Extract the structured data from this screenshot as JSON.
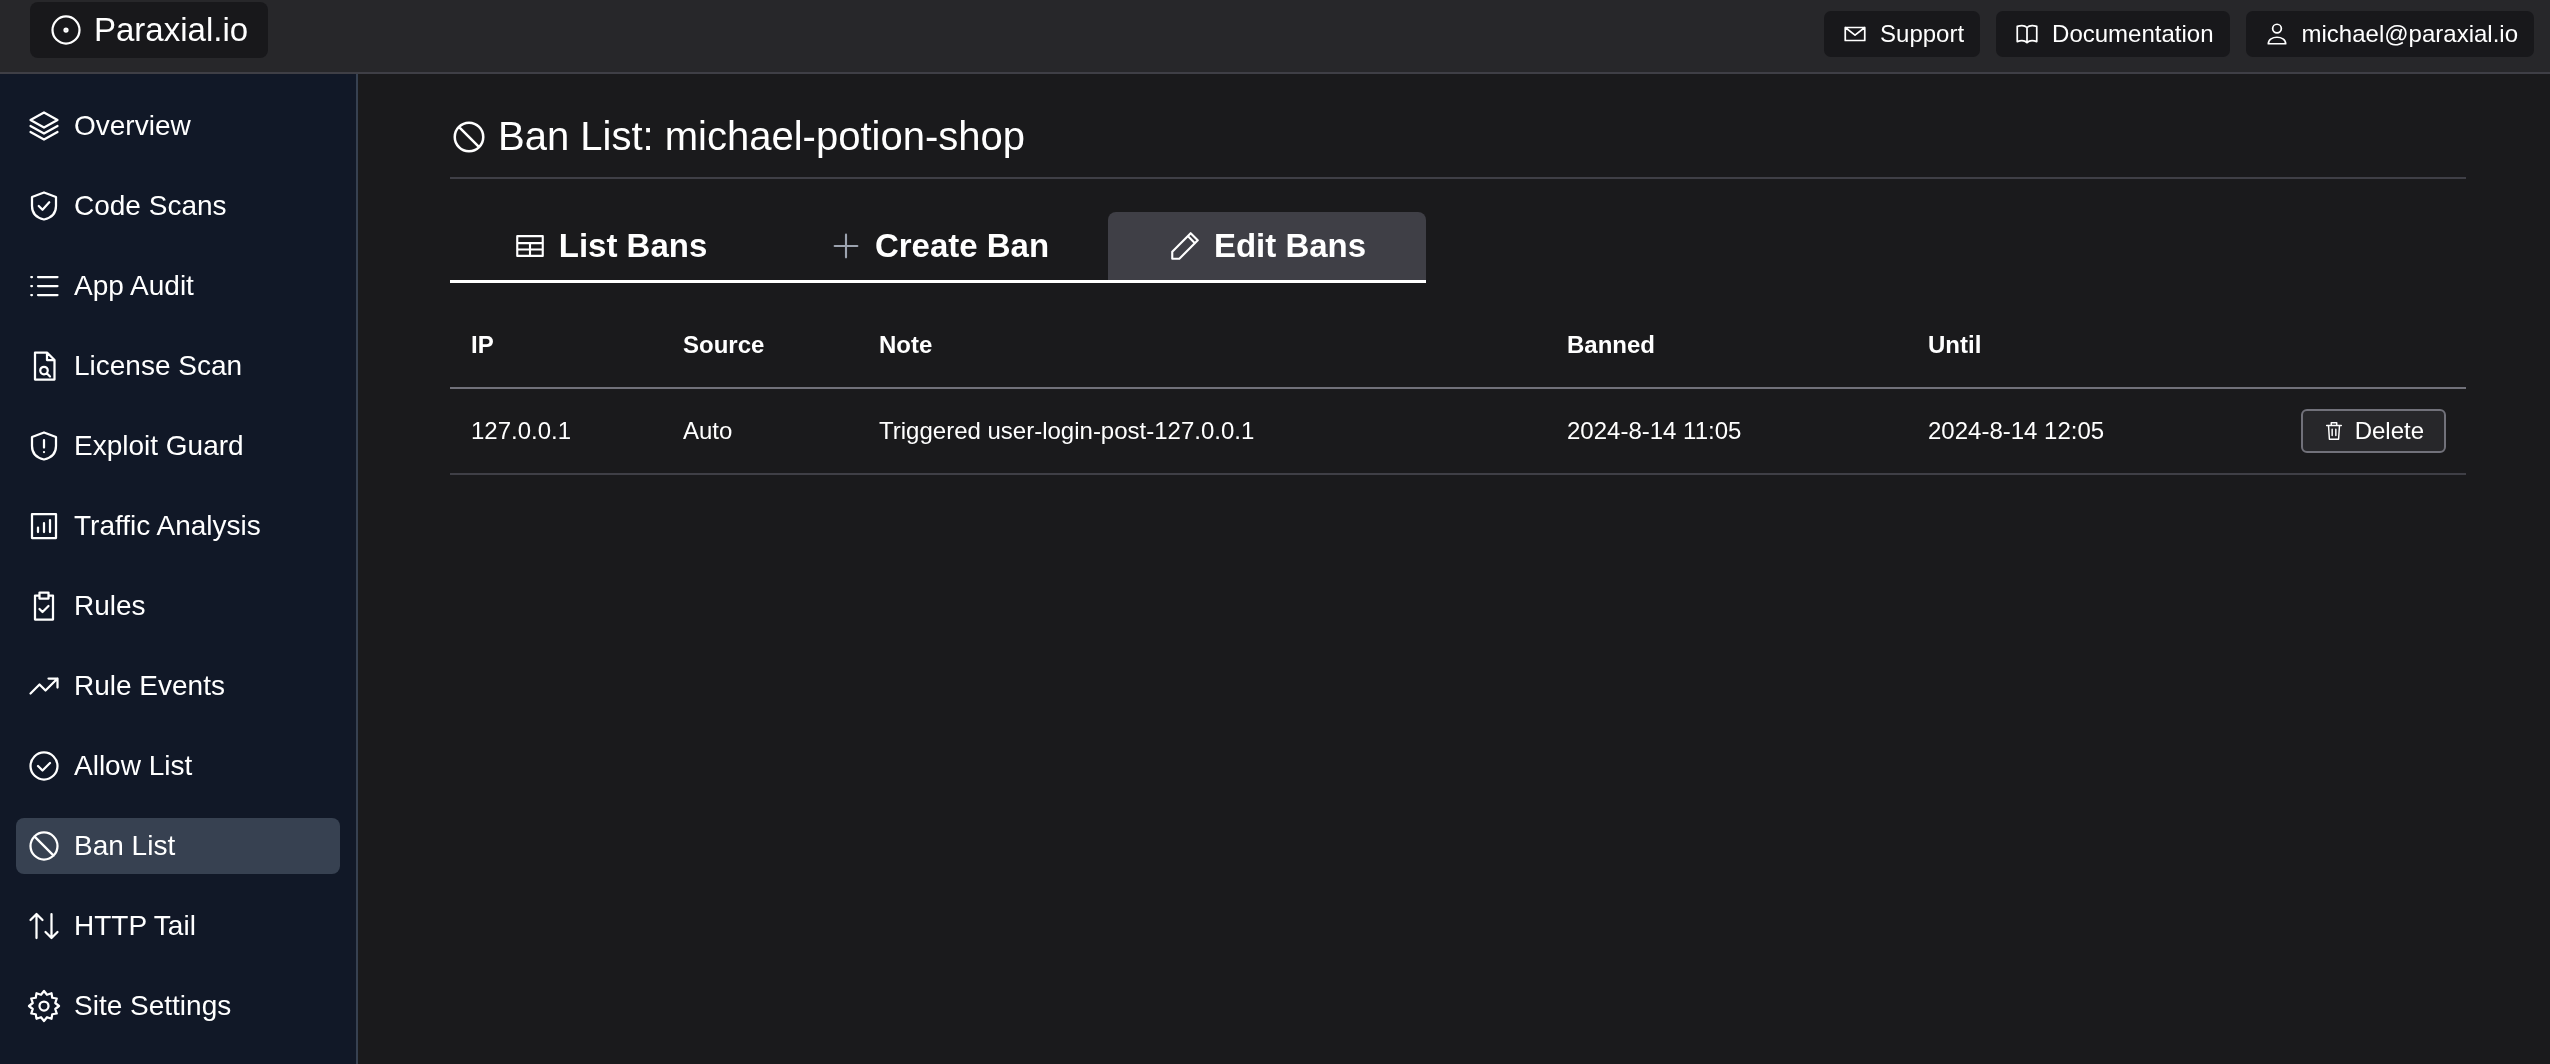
{
  "brand": {
    "name": "Paraxial.io"
  },
  "header_links": [
    {
      "label": "Support"
    },
    {
      "label": "Documentation"
    },
    {
      "label": "michael@paraxial.io"
    }
  ],
  "sidebar": {
    "items": [
      {
        "label": "Overview",
        "selected": false
      },
      {
        "label": "Code Scans",
        "selected": false
      },
      {
        "label": "App Audit",
        "selected": false
      },
      {
        "label": "License Scan",
        "selected": false
      },
      {
        "label": "Exploit Guard",
        "selected": false
      },
      {
        "label": "Traffic Analysis",
        "selected": false
      },
      {
        "label": "Rules",
        "selected": false
      },
      {
        "label": "Rule Events",
        "selected": false
      },
      {
        "label": "Allow List",
        "selected": false
      },
      {
        "label": "Ban List",
        "selected": true
      },
      {
        "label": "HTTP Tail",
        "selected": false
      },
      {
        "label": "Site Settings",
        "selected": false
      }
    ]
  },
  "page": {
    "title": "Ban List: michael-potion-shop",
    "tabs": [
      {
        "label": "List Bans",
        "selected": false
      },
      {
        "label": "Create Ban",
        "selected": false
      },
      {
        "label": "Edit Bans",
        "selected": true
      }
    ],
    "table": {
      "columns": [
        "IP",
        "Source",
        "Note",
        "Banned",
        "Until"
      ],
      "rows": [
        {
          "cells": [
            "127.0.0.1",
            "Auto",
            "Triggered user-login-post-127.0.0.1",
            "2024-8-14 11:05",
            "2024-8-14 12:05"
          ],
          "action": "Delete"
        }
      ]
    }
  }
}
